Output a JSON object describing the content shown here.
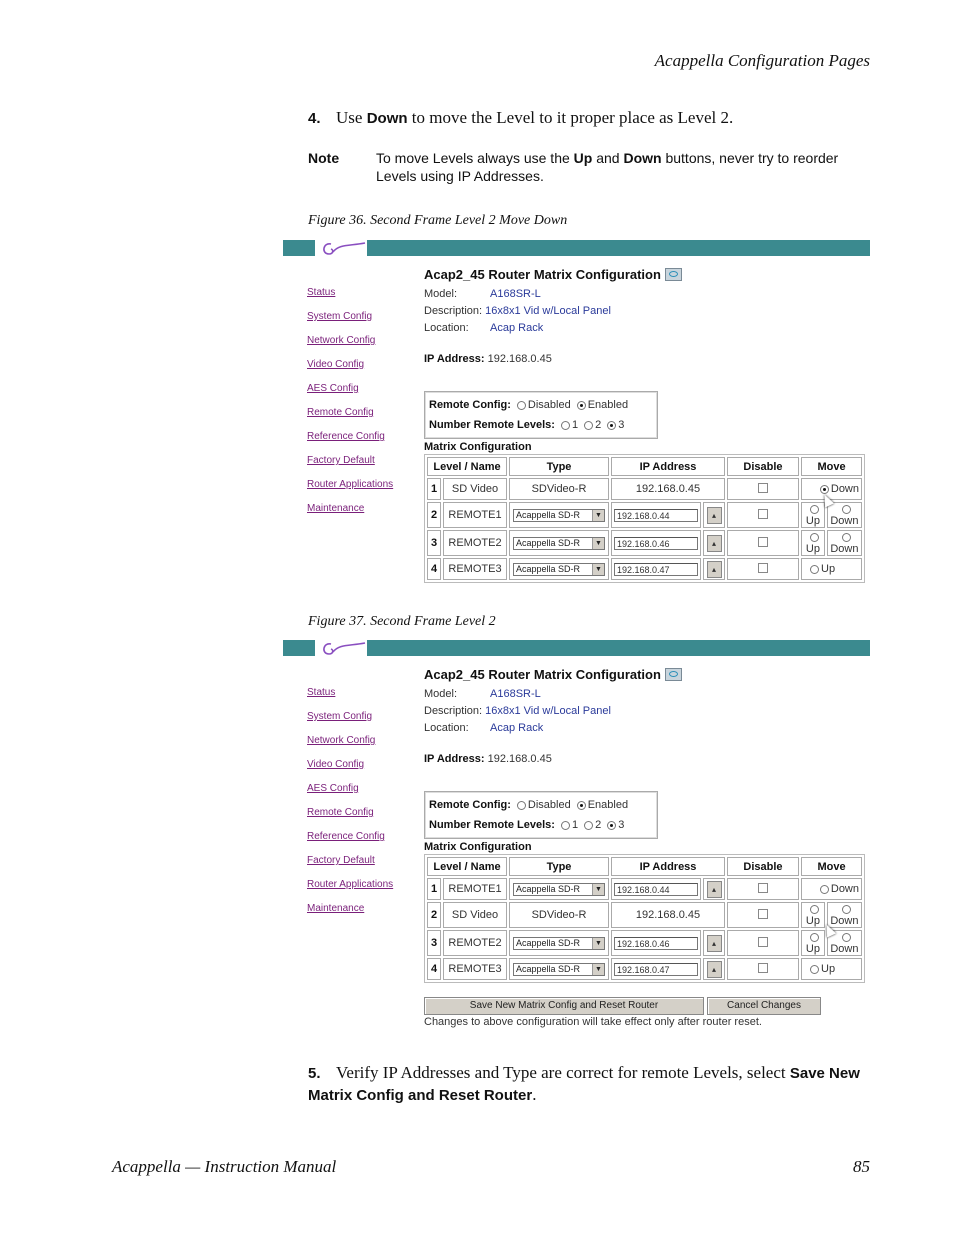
{
  "page": {
    "running_head": "Acappella Configuration Pages",
    "step4": {
      "num": "4.",
      "pre": "Use ",
      "bold": "Down",
      "post": " to move the Level to it proper place as Level 2."
    },
    "note": {
      "label": "Note",
      "t1": "To move Levels always use the ",
      "b1": "Up",
      "t2": " and ",
      "b2": "Down",
      "t3": " buttons, never try to reorder Levels using IP Addresses."
    },
    "fig36_caption": "Figure 36.  Second Frame Level 2 Move Down",
    "fig37_caption": "Figure 37.  Second Frame Level 2",
    "step5": {
      "num": "5.",
      "pre": "Verify IP Addresses and Type are correct for remote Levels, select ",
      "bold": "Save New Matrix Config and Reset Router",
      "post": "."
    },
    "footer_left": "Acappella  —  Instruction Manual",
    "footer_right": "85"
  },
  "app": {
    "brand_color": "#3b8a8f",
    "logo": "GV",
    "title": "Acap2_45 Router Matrix Configuration",
    "nav": [
      "Status",
      "System Config",
      "Network Config",
      "Video Config",
      "AES Config",
      "Remote Config",
      "Reference Config",
      "Factory Default",
      "Router Applications",
      "Maintenance"
    ],
    "model_label": "Model:",
    "model": "A168SR-L",
    "description_label": "Description:",
    "description": "16x8x1 Vid w/Local Panel",
    "location_label": "Location:",
    "location": "Acap Rack",
    "ip_label": "IP Address:",
    "ip": "192.168.0.45",
    "remote_config_label": "Remote Config:",
    "remote_config_options": [
      "Disabled",
      "Enabled"
    ],
    "remote_config_selected": "Enabled",
    "num_remote_label": "Number Remote Levels:",
    "num_remote_options": [
      "1",
      "2",
      "3"
    ],
    "num_remote_selected": "3",
    "matrix_title": "Matrix Configuration",
    "columns": [
      "Level / Name",
      "Type",
      "IP Address",
      "Disable",
      "Move"
    ],
    "up_label": "Up",
    "down_label": "Down",
    "spin_glyph": "▴",
    "save_label": "Save New Matrix Config and Reset Router",
    "cancel_label": "Cancel Changes",
    "reset_note": "Changes to above configuration will take effect only after router reset."
  },
  "figure36": {
    "rows": [
      {
        "level": "1",
        "name": "SD Video",
        "type": "SDVideo-R",
        "ip": "192.168.0.45",
        "local": true,
        "up": false,
        "down": true,
        "down_checked": true
      },
      {
        "level": "2",
        "name": "REMOTE1",
        "type": "Acappella SD-R",
        "ip": "192.168.0.44",
        "local": false,
        "up": true,
        "down": true
      },
      {
        "level": "3",
        "name": "REMOTE2",
        "type": "Acappella SD-R",
        "ip": "192.168.0.46",
        "local": false,
        "up": true,
        "down": true
      },
      {
        "level": "4",
        "name": "REMOTE3",
        "type": "Acappella SD-R",
        "ip": "192.168.0.47",
        "local": false,
        "up": true,
        "down": false
      }
    ]
  },
  "figure37": {
    "rows": [
      {
        "level": "1",
        "name": "REMOTE1",
        "type": "Acappella SD-R",
        "ip": "192.168.0.44",
        "local": false,
        "up": false,
        "down": true
      },
      {
        "level": "2",
        "name": "SD Video",
        "type": "SDVideo-R",
        "ip": "192.168.0.45",
        "local": true,
        "up": true,
        "down": true
      },
      {
        "level": "3",
        "name": "REMOTE2",
        "type": "Acappella SD-R",
        "ip": "192.168.0.46",
        "local": false,
        "up": true,
        "down": true
      },
      {
        "level": "4",
        "name": "REMOTE3",
        "type": "Acappella SD-R",
        "ip": "192.168.0.47",
        "local": false,
        "up": true,
        "down": false
      }
    ]
  }
}
